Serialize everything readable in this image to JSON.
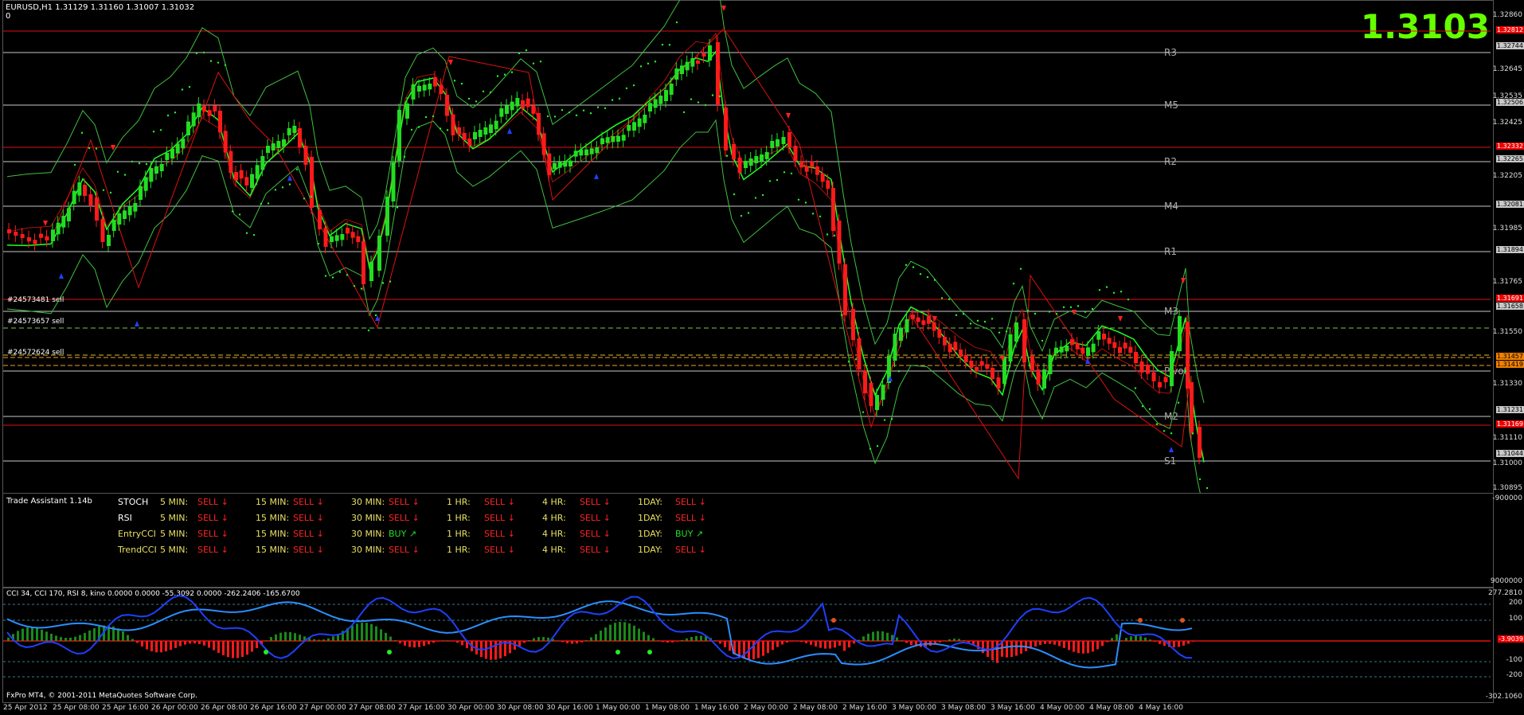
{
  "header": {
    "symbol_line": "EURUSD,H1  1.31129 1.31160 1.31007 1.31032",
    "zero": "0",
    "big_price": "1.3103",
    "big_price_color": "#66ff00"
  },
  "pivot_labels": [
    "R3",
    "M5",
    "R2",
    "M4",
    "R1",
    "M3",
    "Pivot",
    "M2",
    "S1"
  ],
  "order_labels": [
    "#24573481 sell",
    "#24573657 sell",
    "#24572624 sell"
  ],
  "price_axis": {
    "ticks": [
      "1.32860",
      "1.32645",
      "1.32535",
      "1.32425",
      "1.32205",
      "1.31985",
      "1.31765",
      "1.31550",
      "1.31330",
      "1.31110",
      "1.31000",
      "1.30895"
    ],
    "boxes": [
      {
        "text": "1.32812",
        "style": "red"
      },
      {
        "text": "1.32744",
        "style": "gray"
      },
      {
        "text": "1.32506",
        "style": "gray"
      },
      {
        "text": "1.32332",
        "style": "red"
      },
      {
        "text": "1.32265",
        "style": "gray"
      },
      {
        "text": "1.32081",
        "style": "gray"
      },
      {
        "text": "1.31894",
        "style": "gray"
      },
      {
        "text": "1.31691",
        "style": "red"
      },
      {
        "text": "1.31658",
        "style": "gray"
      },
      {
        "text": "1.31457",
        "style": "orange"
      },
      {
        "text": "1.31419",
        "style": "orange"
      },
      {
        "text": "1.31231",
        "style": "gray"
      },
      {
        "text": "1.31169",
        "style": "red"
      },
      {
        "text": "1.31044",
        "style": "gray"
      }
    ]
  },
  "trade_assistant": {
    "title": "Trade Assistant 1.14b",
    "right_value": "-900000",
    "right_value2": "9000000",
    "timeframes": [
      "5 MIN:",
      "15 MIN:",
      "30 MIN:",
      "1 HR:",
      "4 HR:",
      "1DAY:"
    ],
    "rows": [
      {
        "name": "STOCH",
        "signals": [
          "SELL",
          "SELL",
          "SELL",
          "SELL",
          "SELL",
          "SELL"
        ]
      },
      {
        "name": "RSI",
        "signals": [
          "SELL",
          "SELL",
          "SELL",
          "SELL",
          "SELL",
          "SELL"
        ]
      },
      {
        "name": "EntryCCI",
        "signals": [
          "SELL",
          "SELL",
          "BUY",
          "SELL",
          "SELL",
          "BUY"
        ]
      },
      {
        "name": "TrendCCI",
        "signals": [
          "SELL",
          "SELL",
          "SELL",
          "SELL",
          "SELL",
          "SELL"
        ]
      }
    ]
  },
  "cci_pane": {
    "title": "CCI 34, CCI 170, RSI 8, kino  0.0000 0.0000 -55.3092 0.0000 -262.2406 -165.6700",
    "axis": [
      "277.2810",
      "200",
      "100",
      "-100",
      "-200",
      "-302.1060"
    ],
    "value_box": "-3.9039",
    "copyright": "FxPro MT4, © 2001-2011 MetaQuotes Software Corp."
  },
  "time_axis": [
    "25 Apr 2012",
    "25 Apr 08:00",
    "25 Apr 16:00",
    "26 Apr 00:00",
    "26 Apr 08:00",
    "26 Apr 16:00",
    "27 Apr 00:00",
    "27 Apr 08:00",
    "27 Apr 16:00",
    "30 Apr 00:00",
    "30 Apr 08:00",
    "30 Apr 16:00",
    "1 May 00:00",
    "1 May 08:00",
    "1 May 16:00",
    "2 May 00:00",
    "2 May 08:00",
    "2 May 16:00",
    "3 May 00:00",
    "3 May 08:00",
    "3 May 16:00",
    "4 May 00:00",
    "4 May 08:00",
    "4 May 16:00"
  ],
  "colors": {
    "bull": "#22dd22",
    "bear": "#ff1a1a",
    "band": "#3fbf3f",
    "pivot_line": "#c8c8c8",
    "level_red": "#e01010",
    "level_orange": "#f0a020",
    "cci_line": "#2a8fff",
    "cci_line2": "#1e40ff"
  }
}
